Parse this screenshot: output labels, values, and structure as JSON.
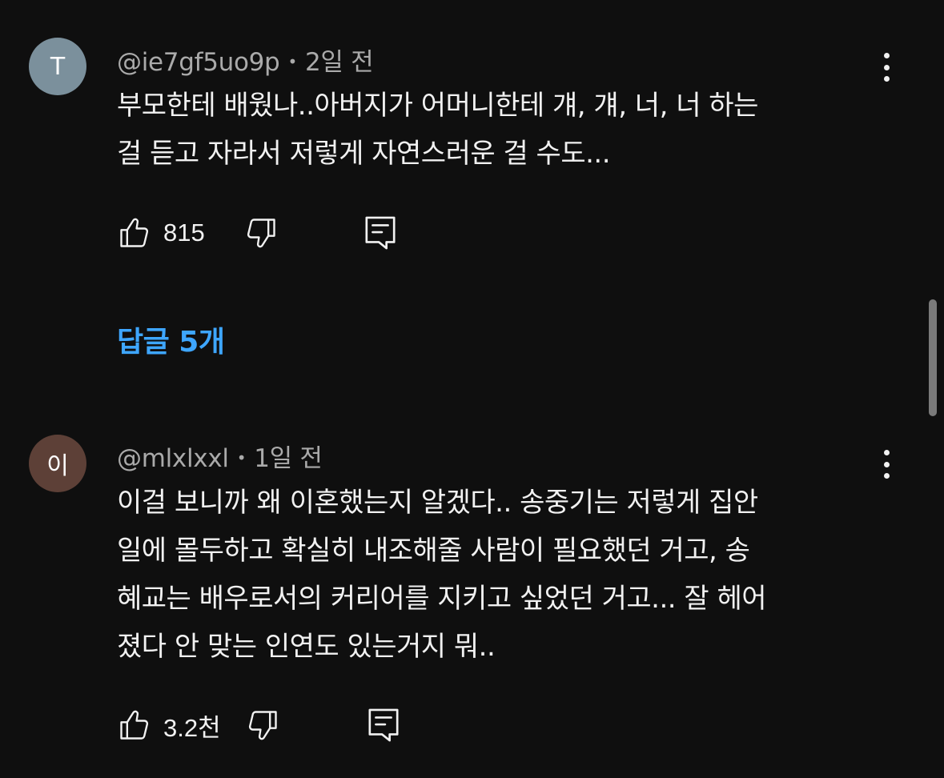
{
  "comments": [
    {
      "avatar_letter": "T",
      "avatar_color": "#7b909c",
      "author": "@ie7gf5uo9p",
      "separator": "•",
      "time": "2일 전",
      "text": "부모한테 배웠나..아버지가 어머니한테 걔, 걔, 너, 너 하는\n걸 듣고 자라서 저렇게 자연스러운 걸 수도...",
      "likes": "815",
      "replies_label": "답글 5개"
    },
    {
      "avatar_letter": "이",
      "avatar_color": "#5d4037",
      "author": "@mlxlxxl",
      "separator": "•",
      "time": "1일 전",
      "text": "이걸 보니까 왜 이혼했는지 알겠다.. 송중기는 저렇게 집안\n일에 몰두하고 확실히 내조해줄 사람이 필요했던 거고, 송\n혜교는 배우로서의 커리어를 지키고 싶었던 거고... 잘 헤어\n졌다 안 맞는 인연도 있는거지 뭐..",
      "likes": "3.2천"
    }
  ],
  "icons": {
    "like": "thumbs-up-icon",
    "dislike": "thumbs-down-icon",
    "reply": "comment-reply-icon",
    "menu": "more-vertical-icon"
  },
  "colors": {
    "background": "#0f0f0f",
    "text": "#f1f1f1",
    "meta": "#aaaaaa",
    "link": "#3ea6ff"
  }
}
